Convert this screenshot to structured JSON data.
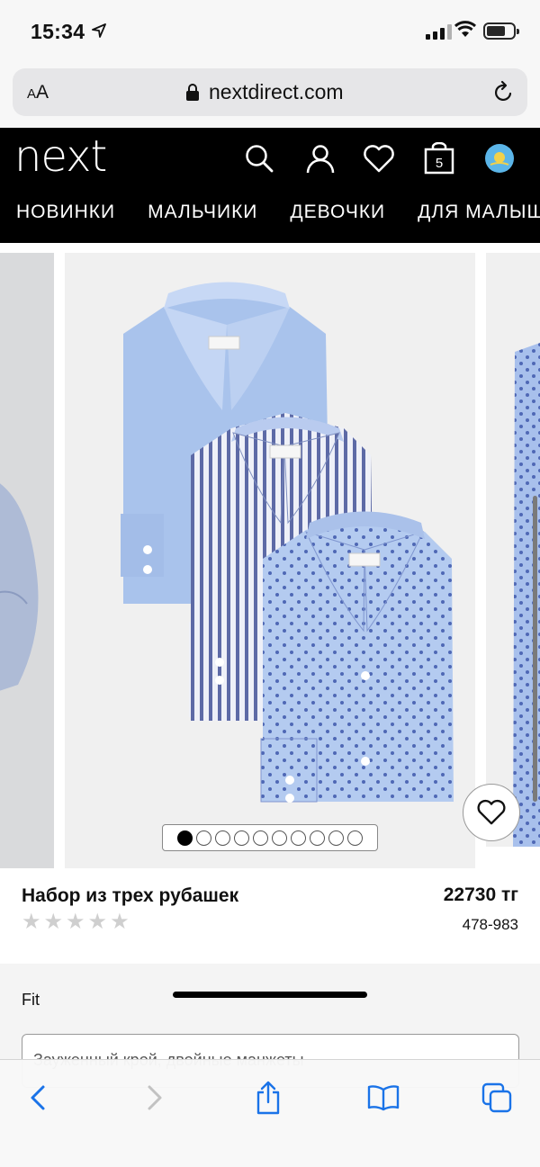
{
  "status_bar": {
    "time": "15:34"
  },
  "browser": {
    "text_size_label_small": "A",
    "text_size_label_large": "A",
    "url": "nextdirect.com"
  },
  "site": {
    "logo": "next",
    "bag_count": "5",
    "nav": [
      "НОВИНКИ",
      "МАЛЬЧИКИ",
      "ДЕВОЧКИ",
      "ДЛЯ МАЛЫШ"
    ]
  },
  "product": {
    "name": "Набор из трех рубашек",
    "price": "22730 тг",
    "code": "478-983",
    "rating_stars": 0,
    "carousel_total": 10,
    "carousel_active": 0
  },
  "options": {
    "fit_label": "Fit",
    "fit_value": "Зауженный крой, двойные манжеты"
  },
  "colors": {
    "header_bg": "#000000",
    "shirt_blue": "#a9c3ec",
    "accent_dark": "#4a5ea8"
  }
}
